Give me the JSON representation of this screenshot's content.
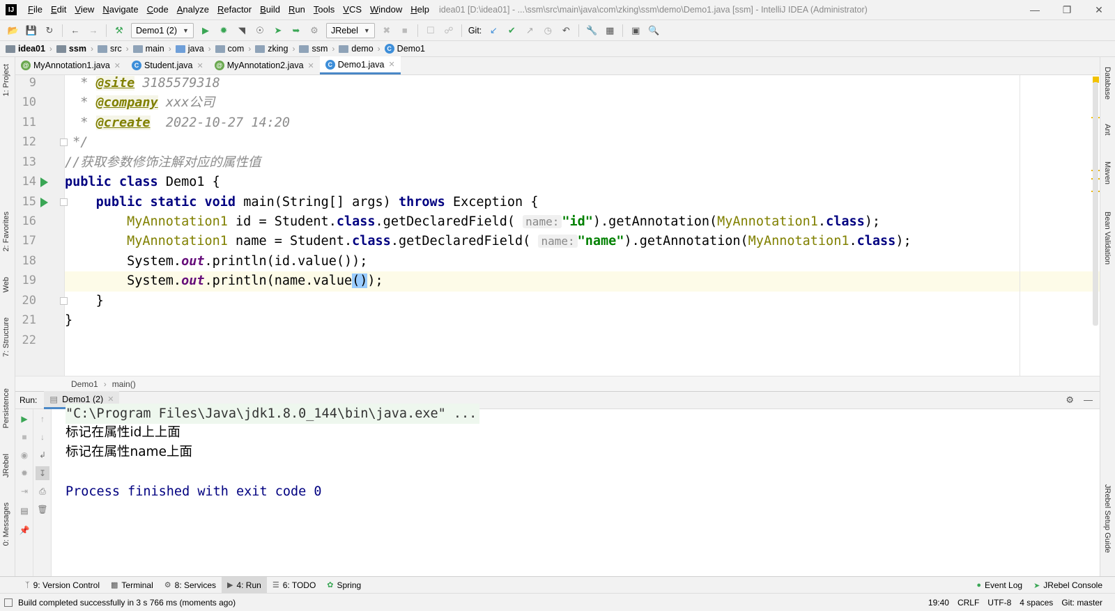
{
  "window": {
    "title": "idea01 [D:\\idea01] - ...\\ssm\\src\\main\\java\\com\\zking\\ssm\\demo\\Demo1.java [ssm] - IntelliJ IDEA (Administrator)"
  },
  "menu": [
    "File",
    "Edit",
    "View",
    "Navigate",
    "Code",
    "Analyze",
    "Refactor",
    "Build",
    "Run",
    "Tools",
    "VCS",
    "Window",
    "Help"
  ],
  "toolbar": {
    "run_config": "Demo1 (2)",
    "jrebel": "JRebel",
    "git_label": "Git:"
  },
  "breadcrumb": [
    "idea01",
    "ssm",
    "src",
    "main",
    "java",
    "com",
    "zking",
    "ssm",
    "demo",
    "Demo1"
  ],
  "editor_tabs": [
    {
      "label": "MyAnnotation1.java",
      "icon": "annotation-icon",
      "active": false
    },
    {
      "label": "Student.java",
      "icon": "class-icon",
      "active": false
    },
    {
      "label": "MyAnnotation2.java",
      "icon": "annotation-icon",
      "active": false
    },
    {
      "label": "Demo1.java",
      "icon": "class-icon",
      "active": true
    }
  ],
  "code": {
    "line_numbers": [
      "9",
      "10",
      "11",
      "12",
      "13",
      "14",
      "15",
      "16",
      "17",
      "18",
      "19",
      "20",
      "21",
      "22"
    ],
    "l9_tag": "@site",
    "l9_val": "3185579318",
    "l10_tag": "@company",
    "l10_val": "xxx公司",
    "l11_tag": "@create",
    "l11_val": "2022-10-27 14:20",
    "l12": " */",
    "l13": "//获取参数修饰注解对应的属性值",
    "l14_kw1": "public",
    "l14_kw2": "class",
    "l14_rest": "Demo1 {",
    "l15_kw1": "public",
    "l15_kw2": "static",
    "l15_kw3": "void",
    "l15_mid": "main(String[] args)",
    "l15_kw4": "throws",
    "l15_rest": "Exception {",
    "l16_type": "MyAnnotation1",
    "l16_a": " id = Student.",
    "l16_kw": "class",
    "l16_b": ".getDeclaredField(",
    "l16_hint": "name:",
    "l16_str": "\"id\"",
    "l16_c": ").getAnnotation(",
    "l16_type2": "MyAnnotation1",
    "l16_d": ".",
    "l16_kw2": "class",
    "l16_e": ");",
    "l17_type": "MyAnnotation1",
    "l17_a": " name = Student.",
    "l17_kw": "class",
    "l17_b": ".getDeclaredField(",
    "l17_hint": "name:",
    "l17_str": "\"name\"",
    "l17_c": ").getAnnotation(",
    "l17_type2": "MyAnnotation1",
    "l17_d": ".",
    "l17_kw2": "class",
    "l17_e": ");",
    "l18_a": "System.",
    "l18_out": "out",
    "l18_b": ".println(id.value());",
    "l19_a": "System.",
    "l19_out": "out",
    "l19_b": ".println(name.value",
    "l19_paren": "()",
    "l19_c": ");",
    "l20": "}",
    "l21": "}"
  },
  "editor_footer": {
    "class": "Demo1",
    "method": "main()"
  },
  "run_panel": {
    "label": "Run:",
    "tab": "Demo1 (2)",
    "console": [
      "\"C:\\Program Files\\Java\\jdk1.8.0_144\\bin\\java.exe\" ...",
      "标记在属性id上上面",
      "标记在属性name上面",
      "",
      "Process finished with exit code 0"
    ]
  },
  "left_tool_windows": [
    "1: Project",
    "2: Favorites",
    "Web",
    "7: Structure",
    "Persistence",
    "JRebel",
    "0: Messages"
  ],
  "right_tool_windows": [
    "Database",
    "Ant",
    "Maven",
    "Bean Validation",
    "JRebel Setup Guide"
  ],
  "bottom_tools": [
    "9: Version Control",
    "Terminal",
    "8: Services",
    "4: Run",
    "6: TODO",
    "Spring"
  ],
  "bottom_right_tools": [
    "Event Log",
    "JRebel Console"
  ],
  "status": {
    "message": "Build completed successfully in 3 s 766 ms (moments ago)",
    "position": "19:40",
    "line_sep": "CRLF",
    "encoding": "UTF-8",
    "indent": "4 spaces",
    "git": "Git: master"
  },
  "colors": {
    "accent": "#4a88c7",
    "run_green": "#3aa655",
    "keyword": "#000080",
    "annotation": "#808000",
    "string": "#008000"
  }
}
